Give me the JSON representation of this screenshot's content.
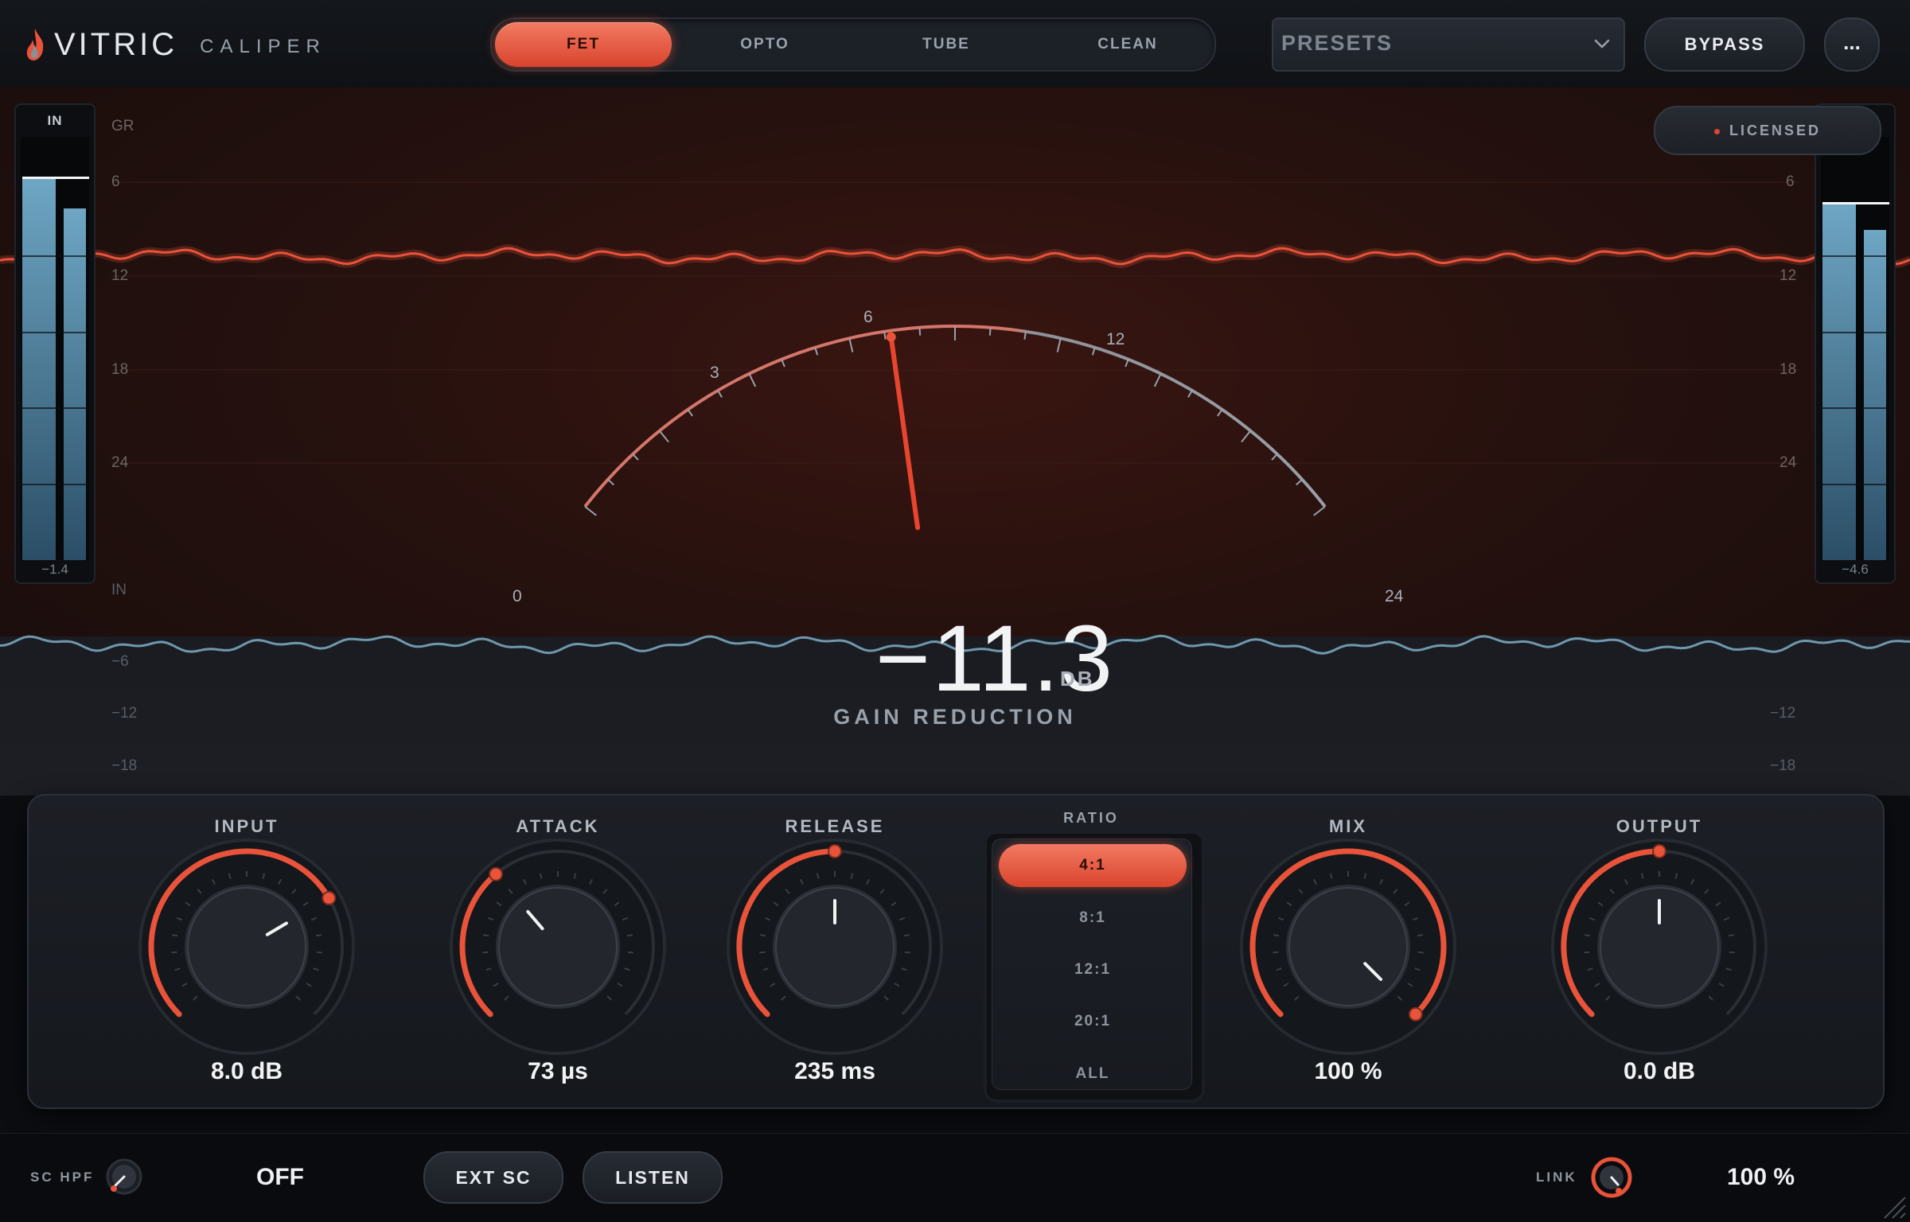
{
  "header": {
    "brand": "VITRIC",
    "product": "CALIPER",
    "modes": [
      {
        "label": "FET",
        "active": true
      },
      {
        "label": "OPTO",
        "active": false
      },
      {
        "label": "TUBE",
        "active": false
      },
      {
        "label": "CLEAN",
        "active": false
      }
    ],
    "presets_label": "PRESETS",
    "bypass_label": "BYPASS",
    "more_label": "..."
  },
  "display": {
    "input_meter": {
      "title": "IN",
      "value": "−1.4",
      "left_level": 0.9,
      "right_level": 0.83
    },
    "output_meter": {
      "value": "−4.6",
      "left_level": 0.84,
      "right_level": 0.78
    },
    "gr_scale_title": "GR",
    "gr_scale": [
      "6",
      "12",
      "18",
      "24"
    ],
    "in_scale_title": "IN",
    "in_scale": [
      "−6",
      "−12",
      "−18"
    ],
    "licensed_label": "LICENSED",
    "dial_ticks": [
      "0",
      "3",
      "6",
      "12",
      "24"
    ],
    "gain_reduction_value": "−11.3",
    "gain_reduction_unit": "DB",
    "gain_reduction_label": "GAIN REDUCTION"
  },
  "controls": {
    "input": {
      "label": "INPUT",
      "value": "8.0 dB",
      "fraction": 0.72
    },
    "attack": {
      "label": "ATTACK",
      "value": "73 µs",
      "fraction": 0.35
    },
    "release": {
      "label": "RELEASE",
      "value": "235 ms",
      "fraction": 0.5
    },
    "ratio": {
      "label": "RATIO",
      "options": [
        "4:1",
        "8:1",
        "12:1",
        "20:1",
        "ALL"
      ],
      "selected": "4:1"
    },
    "mix": {
      "label": "MIX",
      "value": "100 %",
      "fraction": 1.0
    },
    "output": {
      "label": "OUTPUT",
      "value": "0.0 dB",
      "fraction": 0.5
    }
  },
  "footer": {
    "sc_hpf_label": "SC HPF",
    "sc_hpf_value": "OFF",
    "ext_sc_label": "EXT SC",
    "listen_label": "LISTEN",
    "link_label": "LINK",
    "link_value": "100 %"
  },
  "colors": {
    "accent": "#e8533a",
    "meter": "#6ea6c4",
    "background": "#0b0d11"
  }
}
